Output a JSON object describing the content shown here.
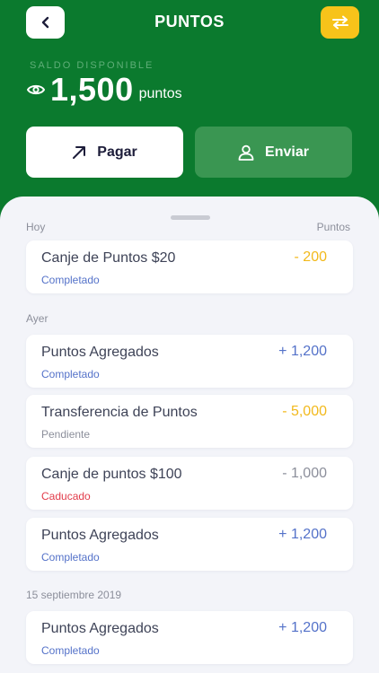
{
  "header": {
    "title": "PUNTOS",
    "saldo_label": "SALDO DISPONIBLE",
    "balance_value": "1,500",
    "balance_unit": "puntos",
    "pay_label": "Pagar",
    "send_label": "Enviar"
  },
  "colors": {
    "brand_green": "#0b7a2e",
    "accent_yellow": "#f7c31a",
    "completed_blue": "#5472c9",
    "expired_red": "#e23b4a"
  },
  "icons": {
    "back": "chevron-left-icon",
    "swap": "swap-arrows-icon",
    "visibility": "eye-icon",
    "pay": "arrow-up-right-icon",
    "send": "user-icon"
  },
  "list": {
    "col_label": "Puntos",
    "groups": [
      {
        "label": "Hoy",
        "items": [
          {
            "title": "Canje de Puntos $20",
            "status": "Completado",
            "amount": "- 200"
          }
        ]
      },
      {
        "label": "Ayer",
        "items": [
          {
            "title": "Puntos Agregados",
            "status": "Completado",
            "amount": "+ 1,200"
          },
          {
            "title": "Transferencia de Puntos",
            "status": "Pendiente",
            "amount": "- 5,000"
          },
          {
            "title": "Canje de puntos $100",
            "status": "Caducado",
            "amount": "- 1,000"
          },
          {
            "title": "Puntos Agregados",
            "status": "Completado",
            "amount": "+ 1,200"
          }
        ]
      },
      {
        "label": "15 septiembre 2019",
        "items": [
          {
            "title": "Puntos Agregados",
            "status": "Completado",
            "amount": "+ 1,200"
          }
        ]
      }
    ]
  }
}
